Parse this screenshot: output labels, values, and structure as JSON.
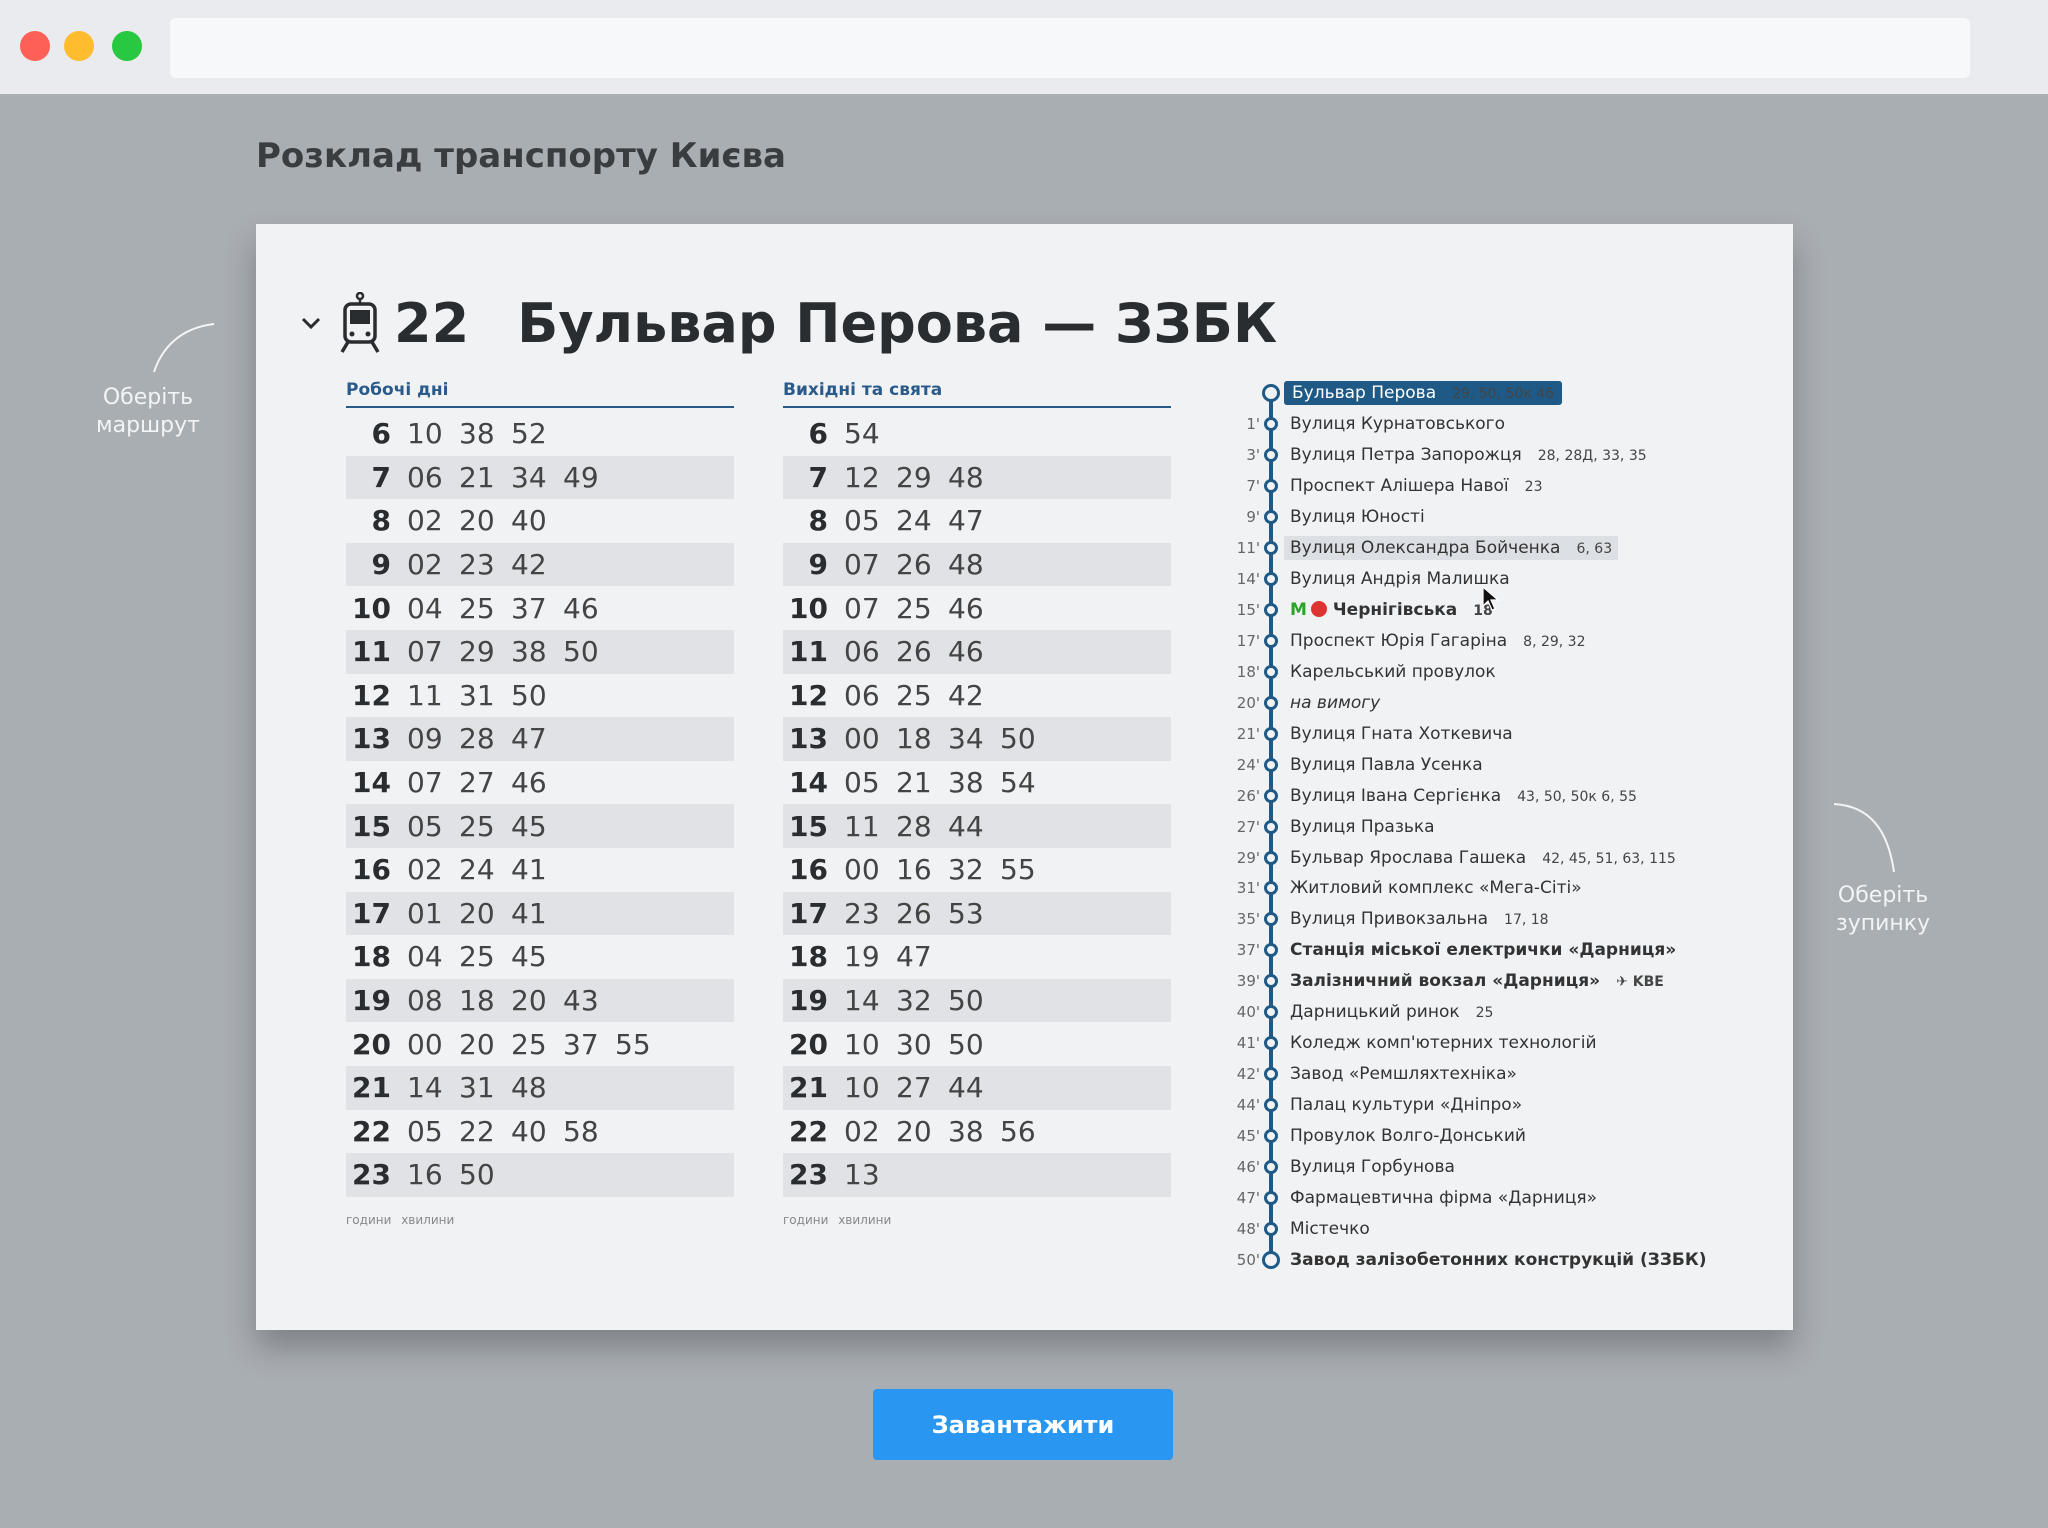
{
  "page": {
    "title": "Розклад транспорту Києва"
  },
  "route": {
    "number": "22",
    "name": "Бульвар Перова — ЗЗБК"
  },
  "hints": {
    "route_line1": "Оберіть",
    "route_line2": "маршрут",
    "stop_line1": "Оберіть",
    "stop_line2": "зупинку"
  },
  "weekday": {
    "title": "Робочі дні",
    "legend": "години хвилини",
    "rows": [
      {
        "h": "6",
        "m": [
          "10",
          "38",
          "52"
        ]
      },
      {
        "h": "7",
        "m": [
          "06",
          "21",
          "34",
          "49"
        ]
      },
      {
        "h": "8",
        "m": [
          "02",
          "20",
          "40"
        ]
      },
      {
        "h": "9",
        "m": [
          "02",
          "23",
          "42"
        ]
      },
      {
        "h": "10",
        "m": [
          "04",
          "25",
          "37",
          "46"
        ]
      },
      {
        "h": "11",
        "m": [
          "07",
          "29",
          "38",
          "50"
        ]
      },
      {
        "h": "12",
        "m": [
          "11",
          "31",
          "50"
        ]
      },
      {
        "h": "13",
        "m": [
          "09",
          "28",
          "47"
        ]
      },
      {
        "h": "14",
        "m": [
          "07",
          "27",
          "46"
        ]
      },
      {
        "h": "15",
        "m": [
          "05",
          "25",
          "45"
        ]
      },
      {
        "h": "16",
        "m": [
          "02",
          "24",
          "41"
        ]
      },
      {
        "h": "17",
        "m": [
          "01",
          "20",
          "41"
        ]
      },
      {
        "h": "18",
        "m": [
          "04",
          "25",
          "45"
        ]
      },
      {
        "h": "19",
        "m": [
          "08",
          "18",
          "20",
          "43"
        ]
      },
      {
        "h": "20",
        "m": [
          "00",
          "20",
          "25",
          "37",
          "55"
        ]
      },
      {
        "h": "21",
        "m": [
          "14",
          "31",
          "48"
        ]
      },
      {
        "h": "22",
        "m": [
          "05",
          "22",
          "40",
          "58"
        ]
      },
      {
        "h": "23",
        "m": [
          "16",
          "50"
        ]
      }
    ]
  },
  "weekend": {
    "title": "Вихідні та свята",
    "legend": "години хвилини",
    "rows": [
      {
        "h": "6",
        "m": [
          "54"
        ]
      },
      {
        "h": "7",
        "m": [
          "12",
          "29",
          "48"
        ]
      },
      {
        "h": "8",
        "m": [
          "05",
          "24",
          "47"
        ]
      },
      {
        "h": "9",
        "m": [
          "07",
          "26",
          "48"
        ]
      },
      {
        "h": "10",
        "m": [
          "07",
          "25",
          "46"
        ]
      },
      {
        "h": "11",
        "m": [
          "06",
          "26",
          "46"
        ]
      },
      {
        "h": "12",
        "m": [
          "06",
          "25",
          "42"
        ]
      },
      {
        "h": "13",
        "m": [
          "00",
          "18",
          "34",
          "50"
        ]
      },
      {
        "h": "14",
        "m": [
          "05",
          "21",
          "38",
          "54"
        ]
      },
      {
        "h": "15",
        "m": [
          "11",
          "28",
          "44"
        ]
      },
      {
        "h": "16",
        "m": [
          "00",
          "16",
          "32",
          "55"
        ]
      },
      {
        "h": "17",
        "m": [
          "23",
          "26",
          "53"
        ]
      },
      {
        "h": "18",
        "m": [
          "19",
          "47"
        ]
      },
      {
        "h": "19",
        "m": [
          "14",
          "32",
          "50"
        ]
      },
      {
        "h": "20",
        "m": [
          "10",
          "30",
          "50"
        ]
      },
      {
        "h": "21",
        "m": [
          "10",
          "27",
          "44"
        ]
      },
      {
        "h": "22",
        "m": [
          "02",
          "20",
          "38",
          "56"
        ]
      },
      {
        "h": "23",
        "m": [
          "13"
        ]
      }
    ]
  },
  "stops": [
    {
      "t": "",
      "name": "Бульвар Перова",
      "transfer": "29, 50, 50к  46",
      "style": "hl"
    },
    {
      "t": "1'",
      "name": "Вулиця Курнатовського",
      "transfer": ""
    },
    {
      "t": "3'",
      "name": "Вулиця Петра Запорожця",
      "transfer": "28, 28Д, 33, 35"
    },
    {
      "t": "7'",
      "name": "Проспект Алішера Навої",
      "transfer": "23"
    },
    {
      "t": "9'",
      "name": "Вулиця Юності",
      "transfer": ""
    },
    {
      "t": "11'",
      "name": "Вулиця Олександра Бойченка",
      "transfer": "6, 63",
      "style": "hl2"
    },
    {
      "t": "14'",
      "name": "Вулиця Андрія Малишка",
      "transfer": ""
    },
    {
      "t": "15'",
      "name": "Чернігівська",
      "transfer": "18",
      "style": "metro"
    },
    {
      "t": "17'",
      "name": "Проспект Юрія Гагаріна",
      "transfer": "8, 29, 32"
    },
    {
      "t": "18'",
      "name": "Карельський провулок",
      "transfer": ""
    },
    {
      "t": "20'",
      "name": "на вимогу",
      "transfer": "",
      "style": "i"
    },
    {
      "t": "21'",
      "name": "Вулиця Гната Хоткевича",
      "transfer": ""
    },
    {
      "t": "24'",
      "name": "Вулиця Павла Усенка",
      "transfer": ""
    },
    {
      "t": "26'",
      "name": "Вулиця Івана Сергієнка",
      "transfer": "43, 50, 50к  6, 55"
    },
    {
      "t": "27'",
      "name": "Вулиця Празька",
      "transfer": ""
    },
    {
      "t": "29'",
      "name": "Бульвар Ярослава Гашека",
      "transfer": "42, 45, 51, 63, 115"
    },
    {
      "t": "31'",
      "name": "Житловий комплекс «Мега-Сіті»",
      "transfer": ""
    },
    {
      "t": "35'",
      "name": "Вулиця Привокзальна",
      "transfer": "17, 18"
    },
    {
      "t": "37'",
      "name": "Станція міської електрички «Дарниця»",
      "transfer": "",
      "style": "b"
    },
    {
      "t": "39'",
      "name": "Залізничний вокзал «Дарниця»",
      "transfer": "✈ KBE",
      "style": "b"
    },
    {
      "t": "40'",
      "name": "Дарницький ринок",
      "transfer": "25"
    },
    {
      "t": "41'",
      "name": "Коледж комп'ютерних технологій",
      "transfer": ""
    },
    {
      "t": "42'",
      "name": "Завод «Ремшляхтехніка»",
      "transfer": ""
    },
    {
      "t": "44'",
      "name": "Палац культури «Дніпро»",
      "transfer": ""
    },
    {
      "t": "45'",
      "name": "Провулок Волго-Донський",
      "transfer": ""
    },
    {
      "t": "46'",
      "name": "Вулиця Горбунова",
      "transfer": ""
    },
    {
      "t": "47'",
      "name": "Фармацевтична фірма «Дарниця»",
      "transfer": ""
    },
    {
      "t": "48'",
      "name": "Містечко",
      "transfer": ""
    },
    {
      "t": "50'",
      "name": "Завод залізобетонних конструкцій (ЗЗБК)",
      "transfer": "",
      "style": "b"
    }
  ],
  "download_button": "Завантажити",
  "colors": {
    "accent": "#1f5a86",
    "button": "#2996f2",
    "metro": "#2aa52a"
  }
}
